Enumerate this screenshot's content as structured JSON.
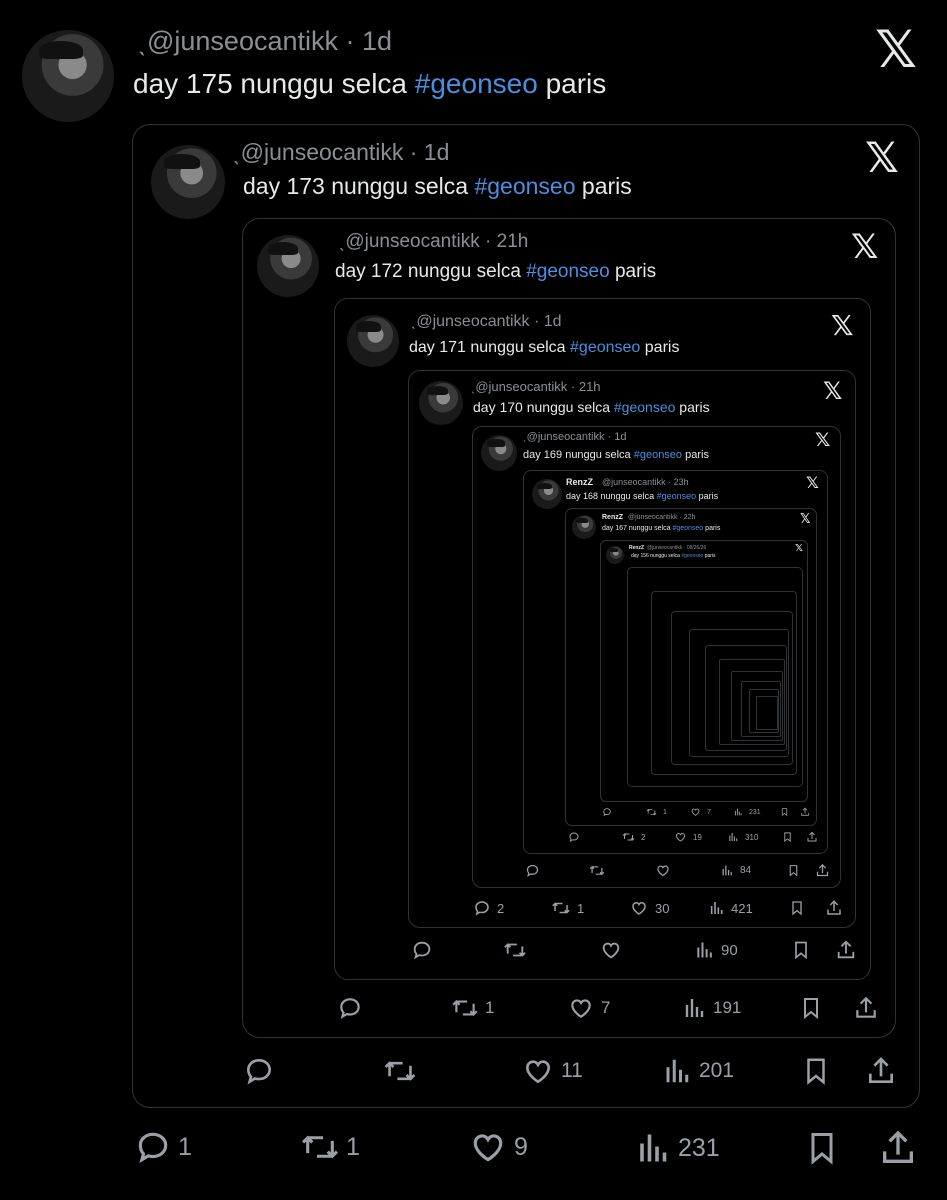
{
  "tweets": [
    {
      "handle": "ˎ@junseocantikk · 1d",
      "day": "day 175 nunggu selca",
      "tag": "#geonseo",
      "place": "paris",
      "reply": "1",
      "retweet": "1",
      "like": "9",
      "views": "231"
    },
    {
      "handle": "ˎ@junseocantikk · 1d",
      "day": "day 173 nunggu selca",
      "tag": "#geonseo",
      "place": "paris",
      "reply": "",
      "retweet": "",
      "like": "11",
      "views": "201"
    },
    {
      "handle": "ˎ@junseocantikk · 21h",
      "day": "day 172 nunggu selca",
      "tag": "#geonseo",
      "place": "paris",
      "reply": "",
      "retweet": "1",
      "like": "7",
      "views": "191"
    },
    {
      "handle": "ˎ@junseocantikk · 1d",
      "day": "day 171 nunggu selca",
      "tag": "#geonseo",
      "place": "paris",
      "reply": "",
      "retweet": "",
      "like": "",
      "views": "90"
    },
    {
      "handle": "ˎ@junseocantikk · 21h",
      "day": "day 170 nunggu selca",
      "tag": "#geonseo",
      "place": "paris",
      "reply": "2",
      "retweet": "1",
      "like": "30",
      "views": "421"
    },
    {
      "handle": "ˎ@junseocantikk · 1d",
      "day": "day 169 nunggu selca",
      "tag": "#geonseo",
      "place": "paris",
      "reply": "",
      "retweet": "",
      "like": "",
      "views": "84"
    },
    {
      "name": "RenzZ",
      "handle": "@junseocantikk · 23h",
      "day": "day 168 nunggu selca",
      "tag": "#geonseo",
      "place": "paris",
      "reply": "",
      "retweet": "2",
      "like": "19",
      "views": "310"
    },
    {
      "name": "RenzZ",
      "handle": "@junseocantikk · 22h",
      "day": "day 167 nunggu selca",
      "tag": "#geonseo",
      "place": "paris",
      "reply": "",
      "retweet": "1",
      "like": "7",
      "views": "231"
    },
    {
      "name": "RenzZ",
      "handle": "@junseocantikk · 08/26/26",
      "day": "day 156 nunggu selca",
      "tag": "#geonseo",
      "place": "paris"
    }
  ],
  "icons": {
    "x_logo": "𝕏"
  },
  "colors": {
    "background": "#000000",
    "hashtag": "#4b8fe0",
    "border": "#2f3336",
    "muted": "#8b8f94"
  }
}
